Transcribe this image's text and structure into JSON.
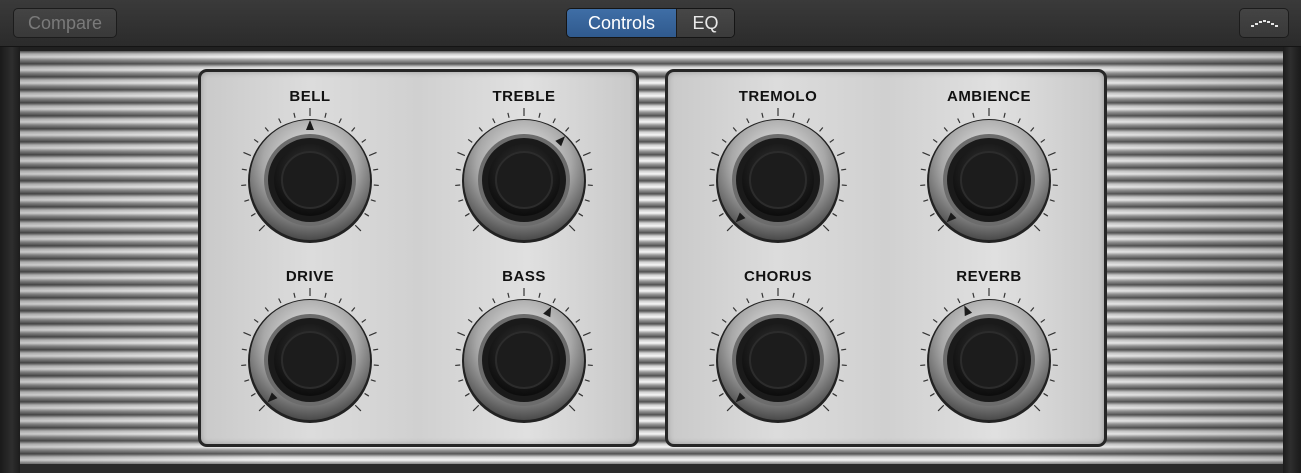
{
  "toolbar": {
    "compare_label": "Compare",
    "view_modes": [
      {
        "label": "Controls",
        "selected": true
      },
      {
        "label": "EQ",
        "selected": false
      }
    ],
    "view_menu_icon": "dotted-line-icon"
  },
  "knobs": [
    {
      "id": "bell",
      "label": "BELL",
      "value": 0.5
    },
    {
      "id": "treble",
      "label": "TREBLE",
      "value": 0.66
    },
    {
      "id": "tremolo",
      "label": "TREMOLO",
      "value": 0.0
    },
    {
      "id": "ambience",
      "label": "AMBIENCE",
      "value": 0.0
    },
    {
      "id": "drive",
      "label": "DRIVE",
      "value": 0.0
    },
    {
      "id": "bass",
      "label": "BASS",
      "value": 0.6
    },
    {
      "id": "chorus",
      "label": "CHORUS",
      "value": 0.0
    },
    {
      "id": "reverb",
      "label": "REVERB",
      "value": 0.41
    }
  ],
  "colors": {
    "accent": "#3a679e",
    "panel": "#d6d6d6",
    "label": "#111111"
  }
}
